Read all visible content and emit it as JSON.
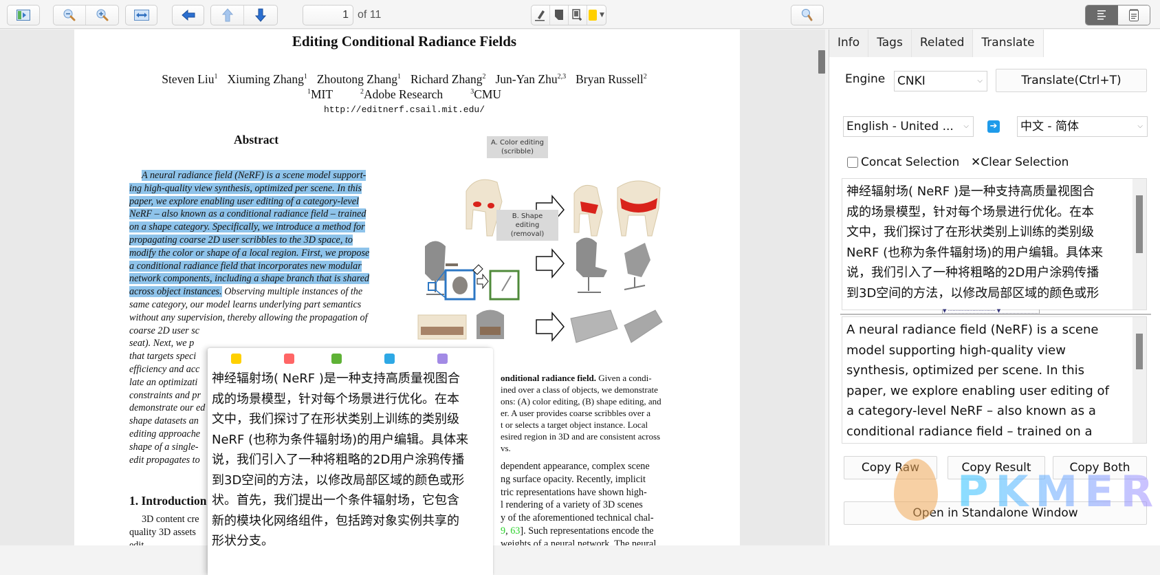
{
  "toolbar": {
    "page_current": "1",
    "page_total_label": "of 11",
    "highlight_color": "#ffd000",
    "buttons": [
      {
        "name": "toggle-sidebar",
        "icon": "sidebar-toggle-icon"
      },
      {
        "name": "zoom-out",
        "icon": "zoom-out-icon"
      },
      {
        "name": "zoom-in",
        "icon": "zoom-in-icon"
      },
      {
        "name": "fit-width",
        "icon": "fit-width-icon"
      },
      {
        "name": "back",
        "icon": "arrow-left-icon"
      },
      {
        "name": "previous-page",
        "icon": "arrow-up-icon"
      },
      {
        "name": "next-page",
        "icon": "arrow-down-icon"
      },
      {
        "name": "highlight",
        "icon": "highlighter-icon"
      },
      {
        "name": "note",
        "icon": "note-icon"
      },
      {
        "name": "area-select",
        "icon": "area-select-icon"
      },
      {
        "name": "color-picker",
        "icon": "color-swatch-icon"
      },
      {
        "name": "search",
        "icon": "search-icon"
      },
      {
        "name": "view-annotations",
        "icon": "list-icon"
      },
      {
        "name": "view-notes",
        "icon": "notepad-icon"
      }
    ]
  },
  "document": {
    "title": "Editing Conditional Radiance Fields",
    "authors": [
      {
        "name": "Steven Liu",
        "sup": "1"
      },
      {
        "name": "Xiuming Zhang",
        "sup": "1"
      },
      {
        "name": "Zhoutong Zhang",
        "sup": "1"
      },
      {
        "name": "Richard Zhang",
        "sup": "2"
      },
      {
        "name": "Jun-Yan Zhu",
        "sup": "2,3"
      },
      {
        "name": "Bryan Russell",
        "sup": "2"
      }
    ],
    "affiliations": [
      {
        "sup": "1",
        "name": "MIT"
      },
      {
        "sup": "2",
        "name": "Adobe Research"
      },
      {
        "sup": "3",
        "name": "CMU"
      }
    ],
    "url": "http://editnerf.csail.mit.edu/",
    "abstract_heading": "Abstract",
    "abstract_highlighted_lines": [
      "A neural radiance field (NeRF) is a scene model support-",
      "ing high-quality view synthesis, optimized per scene. In this",
      "paper, we explore enabling user editing of a category-level",
      "NeRF – also known as a conditional radiance field – trained",
      "on a shape category. Specifically, we introduce a method for",
      "propagating coarse 2D user scribbles to the 3D space, to",
      "modify the color or shape of a local region. First, we propose",
      "a conditional radiance field that incorporates new modular",
      "network components, including a shape branch that is shared"
    ],
    "abstract_mixed_line": {
      "highlighted": "across object instances.",
      "rest": " Observing multiple instances of the"
    },
    "abstract_rest_lines": [
      "same category, our model learns underlying part semantics",
      "without any supervision, thereby allowing the propagation of",
      "coarse 2D user sc",
      "seat).  Next, we p",
      "that targets speci",
      "efficiency and acc",
      "late an optimizati",
      "constraints and pr",
      "demonstrate our ed",
      "shape datasets an",
      "editing approache",
      "shape of a single-",
      "edit propagates to"
    ],
    "figure_labels": {
      "a": [
        "A. Color editing",
        "(scribble)"
      ],
      "b": [
        "B. Shape editing",
        "(removal)"
      ]
    },
    "caption_lines": [
      {
        "bold": "onditional radiance field.",
        "text": "  Given a condi-"
      },
      {
        "bold": "",
        "text": "ined over a class of objects, we demonstrate"
      },
      {
        "bold": "",
        "text": "ons: (A) color editing, (B) shape editing, and"
      },
      {
        "bold": "",
        "text": "er.  A user provides coarse scribbles over a"
      },
      {
        "bold": "",
        "text": "t or selects a target object instance.  Local"
      },
      {
        "bold": "",
        "text": "esired region in 3D and are consistent across"
      },
      {
        "bold": "",
        "text": "vs."
      }
    ],
    "body_lines": [
      "dependent appearance, complex scene",
      "ng surface opacity.  Recently, implicit",
      "tric representations have shown high-",
      "l rendering of a variety of 3D scenes",
      "y of the aforementioned technical chal-"
    ],
    "body_cite_line": {
      "pre": "",
      "cite1": "9",
      "sep": ", ",
      "cite2": "63",
      "post": "]. Such representations encode the"
    },
    "body_last_line": "weights of a neural network. The neural",
    "intro_heading": "1. Introduction",
    "intro_lines": [
      "3D content cre",
      "quality 3D assets",
      "edit..."
    ]
  },
  "popup": {
    "swatch_colors": [
      "#ffd000",
      "#ff6666",
      "#5fb236",
      "#2ea8e5",
      "#a28ae5"
    ],
    "swatch_names": [
      "yellow",
      "red",
      "green",
      "blue",
      "purple"
    ],
    "translation_lines": [
      "神经辐射场( NeRF )是一种支持高质量视图合",
      "成的场景模型，针对每个场景进行优化。在本",
      "文中，我们探讨了在形状类别上训练的类别级",
      "NeRF (也称为条件辐射场)的用户编辑。具体来",
      "说，我们引入了一种将粗略的2D用户涂鸦传播",
      "到3D空间的方法，以修改局部区域的颜色或形",
      "状。首先，我们提出一个条件辐射场，它包含",
      "新的模块化网络组件，包括跨对象实例共享的",
      "形状分支。"
    ]
  },
  "right_pane": {
    "tabs": [
      {
        "label": "Info",
        "active": false
      },
      {
        "label": "Tags",
        "active": false
      },
      {
        "label": "Related",
        "active": false
      },
      {
        "label": "Translate",
        "active": true
      }
    ],
    "engine_label": "Engine",
    "engine_value": "CNKI",
    "translate_button": "Translate(Ctrl+T)",
    "source_language": "English - United ...",
    "target_language": "中文 - 简体",
    "swap_icon": "arrow-right-icon",
    "concat_selection_label": "Concat Selection",
    "concat_selection_checked": false,
    "clear_selection_label": "✕Clear Selection",
    "result_lines": [
      "神经辐射场( NeRF )是一种支持高质量视图合",
      "成的场景模型，针对每个场景进行优化。在本",
      "文中，我们探讨了在形状类别上训练的类别级",
      "NeRF (也称为条件辐射场)的用户编辑。具体来",
      "说，我们引入了一种将粗略的2D用户涂鸦传播",
      "到3D空间的方法，以修改局部区域的颜色或形"
    ],
    "source_lines": [
      "A neural radiance field (NeRF) is a scene",
      "model supporting high-quality view",
      "synthesis, optimized per scene. In this",
      "paper, we explore enabling user editing of",
      "a category-level NeRF – also known as a",
      "conditional radiance field – trained on a"
    ],
    "copy_raw": "Copy Raw",
    "copy_result": "Copy Result",
    "copy_both": "Copy Both",
    "open_standalone": "Open in Standalone Window"
  },
  "watermark": {
    "text": "PKMER"
  }
}
